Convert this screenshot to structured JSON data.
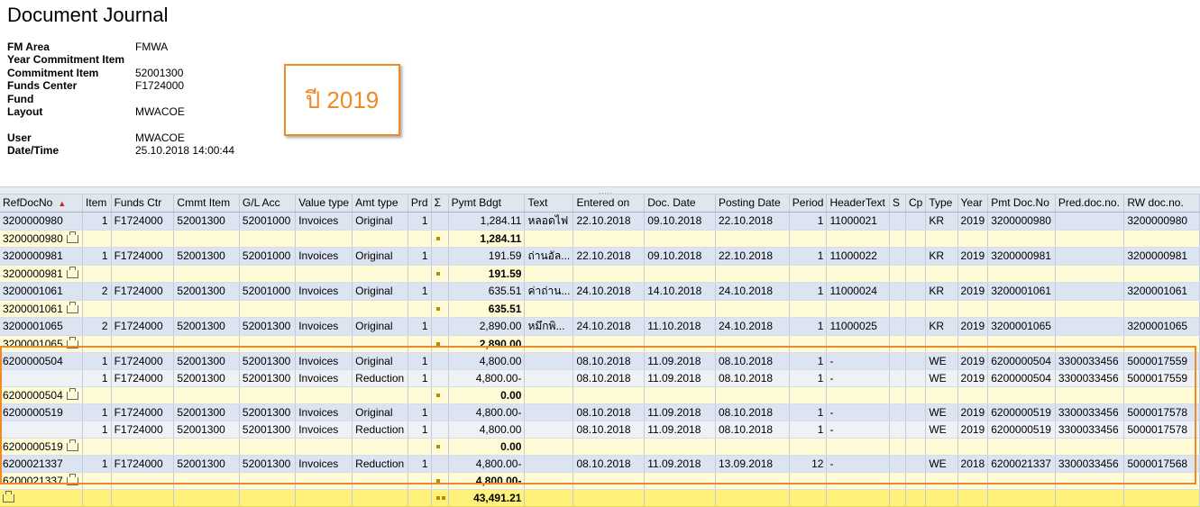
{
  "page": {
    "title": "Document Journal"
  },
  "header": {
    "fields": [
      {
        "label": "FM Area",
        "value": "FMWA"
      },
      {
        "label": "Year Commitment Item",
        "value": ""
      },
      {
        "label": "Commitment Item",
        "value": "52001300"
      },
      {
        "label": "Funds Center",
        "value": "F1724000"
      },
      {
        "label": "Fund",
        "value": ""
      },
      {
        "label": "Layout",
        "value": "MWACOE"
      }
    ],
    "fields2": [
      {
        "label": "User",
        "value": "MWACOE"
      },
      {
        "label": "Date/Time",
        "value": "25.10.2018 14:00:44"
      }
    ]
  },
  "callout": {
    "text": "ปี 2019",
    "color": "#f08a24"
  },
  "splitter": {
    "grip": "....."
  },
  "table": {
    "columns": [
      "RefDocNo",
      "Item",
      "Funds Ctr",
      "Cmmt Item",
      "G/L Acc",
      "Value type",
      "Amt type",
      "Prd",
      "Σ",
      "Pymt Bdgt",
      "Text",
      "Entered on",
      "Doc. Date",
      "Posting Date",
      "Period",
      "HeaderText",
      "S",
      "Cp",
      "Type",
      "Year",
      "Pmt Doc.No",
      "Pred.doc.no.",
      "RW doc.no."
    ],
    "rows": [
      {
        "kind": "data",
        "alt": false,
        "cells": [
          "3200000980",
          "1",
          "F1724000",
          "52001300",
          "52001000",
          "Invoices",
          "Original",
          "1",
          "",
          "1,284.11",
          "หลอดไฟ",
          "22.10.2018",
          "09.10.2018",
          "22.10.2018",
          "1",
          "11000021",
          "",
          "",
          "KR",
          "2019",
          "3200000980",
          "",
          "3200000980"
        ]
      },
      {
        "kind": "sub",
        "ref": "3200000980",
        "amount": "1,284.11"
      },
      {
        "kind": "data",
        "alt": false,
        "cells": [
          "3200000981",
          "1",
          "F1724000",
          "52001300",
          "52001000",
          "Invoices",
          "Original",
          "1",
          "",
          "191.59",
          "ถ่านอัล...",
          "22.10.2018",
          "09.10.2018",
          "22.10.2018",
          "1",
          "11000022",
          "",
          "",
          "KR",
          "2019",
          "3200000981",
          "",
          "3200000981"
        ]
      },
      {
        "kind": "sub",
        "ref": "3200000981",
        "amount": "191.59"
      },
      {
        "kind": "data",
        "alt": false,
        "cells": [
          "3200001061",
          "2",
          "F1724000",
          "52001300",
          "52001000",
          "Invoices",
          "Original",
          "1",
          "",
          "635.51",
          "ค่าถ่าน...",
          "24.10.2018",
          "14.10.2018",
          "24.10.2018",
          "1",
          "11000024",
          "",
          "",
          "KR",
          "2019",
          "3200001061",
          "",
          "3200001061"
        ]
      },
      {
        "kind": "sub",
        "ref": "3200001061",
        "amount": "635.51"
      },
      {
        "kind": "data",
        "alt": false,
        "cells": [
          "3200001065",
          "2",
          "F1724000",
          "52001300",
          "52001300",
          "Invoices",
          "Original",
          "1",
          "",
          "2,890.00",
          "หมึกพิ...",
          "24.10.2018",
          "11.10.2018",
          "24.10.2018",
          "1",
          "11000025",
          "",
          "",
          "KR",
          "2019",
          "3200001065",
          "",
          "3200001065"
        ]
      },
      {
        "kind": "sub",
        "ref": "3200001065",
        "amount": "2,890.00"
      },
      {
        "kind": "data",
        "alt": false,
        "cells": [
          "6200000504",
          "1",
          "F1724000",
          "52001300",
          "52001300",
          "Invoices",
          "Original",
          "1",
          "",
          "4,800.00",
          "",
          "08.10.2018",
          "11.09.2018",
          "08.10.2018",
          "1",
          "-",
          "",
          "",
          "WE",
          "2019",
          "6200000504",
          "3300033456",
          "5000017559"
        ]
      },
      {
        "kind": "data",
        "alt": true,
        "cells": [
          "",
          "1",
          "F1724000",
          "52001300",
          "52001300",
          "Invoices",
          "Reduction",
          "1",
          "",
          "4,800.00-",
          "",
          "08.10.2018",
          "11.09.2018",
          "08.10.2018",
          "1",
          "-",
          "",
          "",
          "WE",
          "2019",
          "6200000504",
          "3300033456",
          "5000017559"
        ]
      },
      {
        "kind": "sub",
        "ref": "6200000504",
        "amount": "0.00"
      },
      {
        "kind": "data",
        "alt": false,
        "cells": [
          "6200000519",
          "1",
          "F1724000",
          "52001300",
          "52001300",
          "Invoices",
          "Original",
          "1",
          "",
          "4,800.00-",
          "",
          "08.10.2018",
          "11.09.2018",
          "08.10.2018",
          "1",
          "-",
          "",
          "",
          "WE",
          "2019",
          "6200000519",
          "3300033456",
          "5000017578"
        ]
      },
      {
        "kind": "data",
        "alt": true,
        "cells": [
          "",
          "1",
          "F1724000",
          "52001300",
          "52001300",
          "Invoices",
          "Reduction",
          "1",
          "",
          "4,800.00",
          "",
          "08.10.2018",
          "11.09.2018",
          "08.10.2018",
          "1",
          "-",
          "",
          "",
          "WE",
          "2019",
          "6200000519",
          "3300033456",
          "5000017578"
        ]
      },
      {
        "kind": "sub",
        "ref": "6200000519",
        "amount": "0.00"
      },
      {
        "kind": "data",
        "alt": false,
        "cells": [
          "6200021337",
          "1",
          "F1724000",
          "52001300",
          "52001300",
          "Invoices",
          "Reduction",
          "1",
          "",
          "4,800.00-",
          "",
          "08.10.2018",
          "11.09.2018",
          "13.09.2018",
          "12",
          "-",
          "",
          "",
          "WE",
          "2018",
          "6200021337",
          "3300033456",
          "5000017568"
        ]
      },
      {
        "kind": "sub",
        "ref": "6200021337",
        "amount": "4,800.00-"
      },
      {
        "kind": "total",
        "amount": "43,491.21"
      }
    ]
  },
  "colors": {
    "highlight_border": "#f08a24",
    "total_row": "#fff27a",
    "subtotal_row": "#fffbd6",
    "data_row": "#dbe4f0"
  },
  "icons": {
    "sort": "sort-ascending-icon",
    "subtotal": "subtotal-icon",
    "total": "total-icon"
  }
}
